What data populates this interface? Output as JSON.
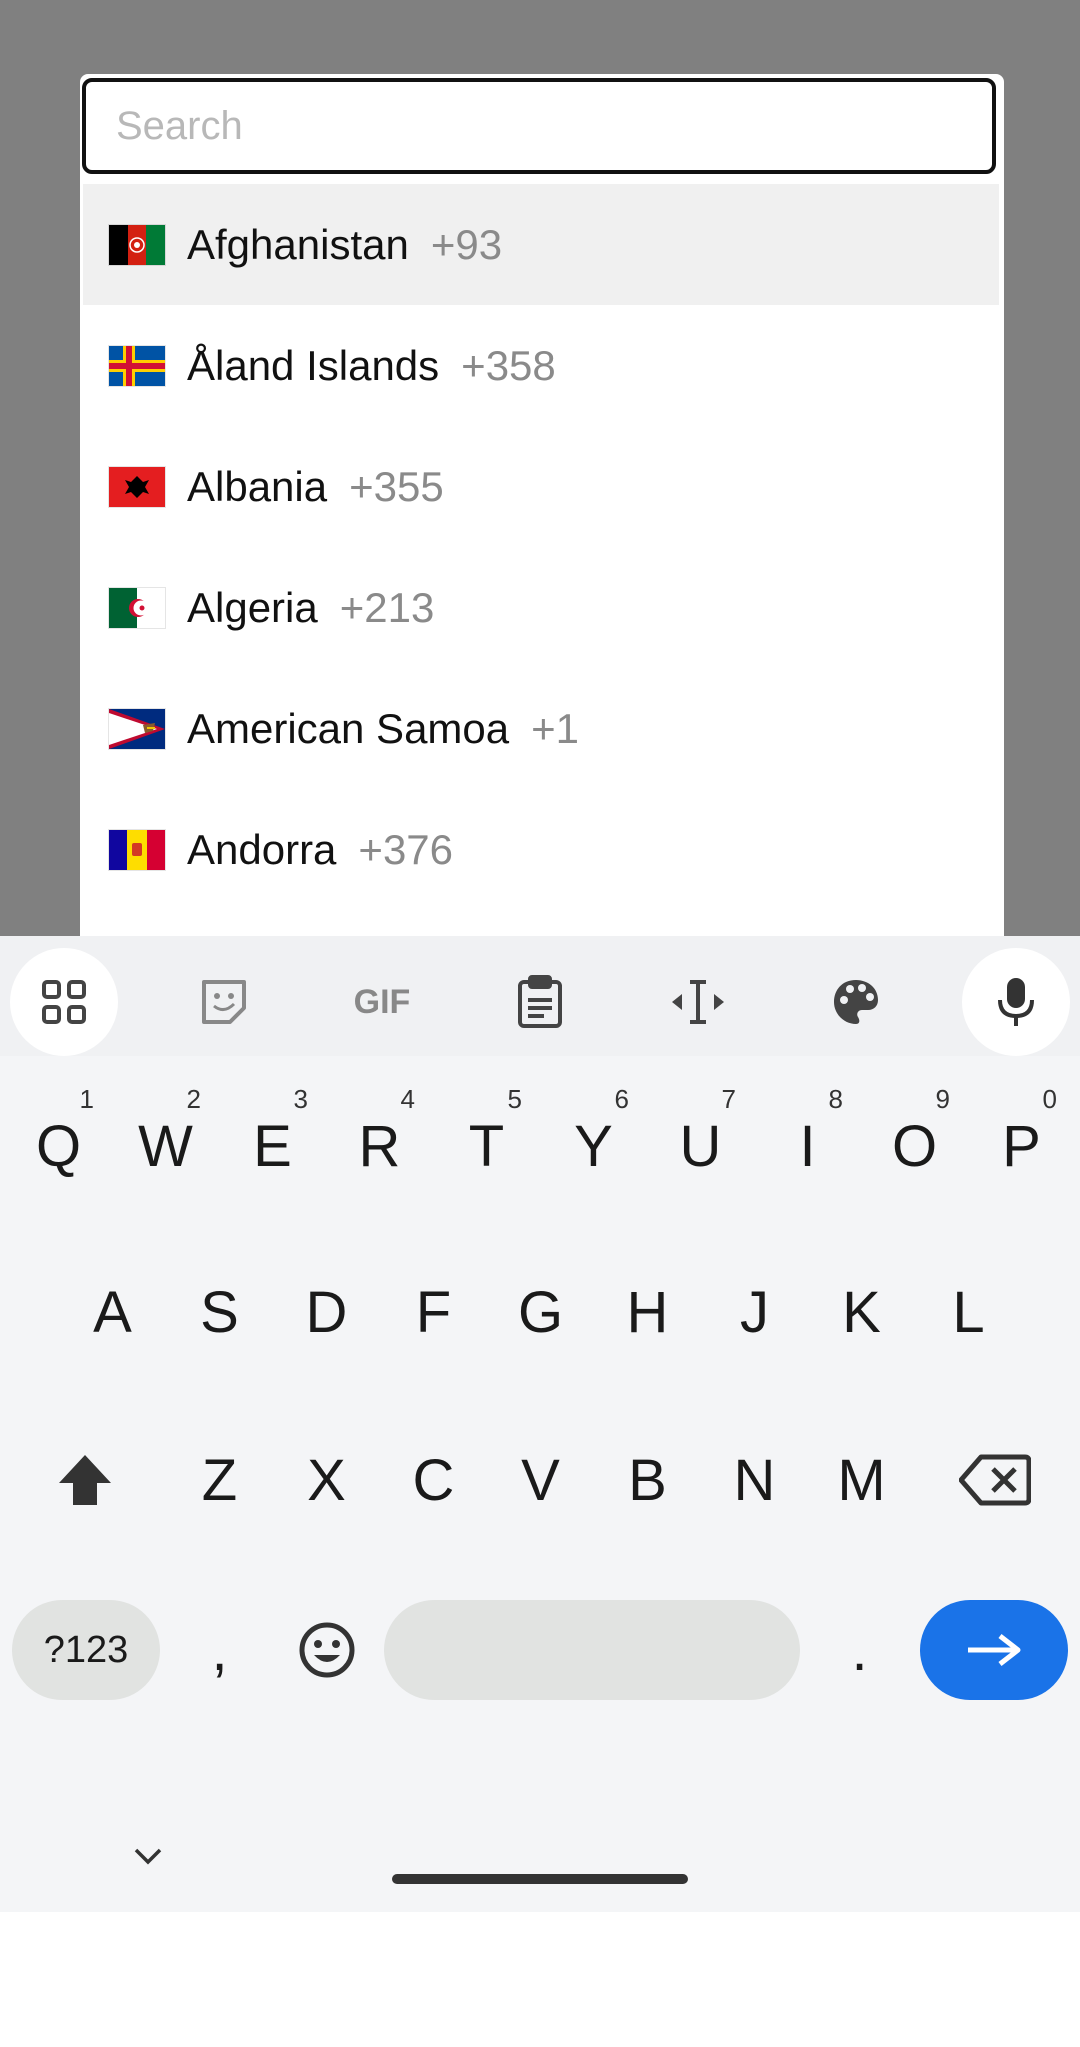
{
  "search": {
    "placeholder": "Search",
    "value": ""
  },
  "countries": [
    {
      "name": "Afghanistan",
      "code": "+93",
      "flag_icon": "afghanistan-flag-icon",
      "selected": true
    },
    {
      "name": "Åland Islands",
      "code": "+358",
      "flag_icon": "aland-islands-flag-icon",
      "selected": false
    },
    {
      "name": "Albania",
      "code": "+355",
      "flag_icon": "albania-flag-icon",
      "selected": false
    },
    {
      "name": "Algeria",
      "code": "+213",
      "flag_icon": "algeria-flag-icon",
      "selected": false
    },
    {
      "name": "American Samoa",
      "code": "+1",
      "flag_icon": "american-samoa-flag-icon",
      "selected": false
    },
    {
      "name": "Andorra",
      "code": "+376",
      "flag_icon": "andorra-flag-icon",
      "selected": false
    }
  ],
  "keyboard": {
    "toolbar": {
      "gif_label": "GIF",
      "icons": [
        "apps-grid-icon",
        "sticker-icon",
        "gif-icon",
        "clipboard-icon",
        "text-cursor-icon",
        "palette-icon",
        "microphone-icon"
      ]
    },
    "row1": [
      {
        "key": "Q",
        "hint": "1"
      },
      {
        "key": "W",
        "hint": "2"
      },
      {
        "key": "E",
        "hint": "3"
      },
      {
        "key": "R",
        "hint": "4"
      },
      {
        "key": "T",
        "hint": "5"
      },
      {
        "key": "Y",
        "hint": "6"
      },
      {
        "key": "U",
        "hint": "7"
      },
      {
        "key": "I",
        "hint": "8"
      },
      {
        "key": "O",
        "hint": "9"
      },
      {
        "key": "P",
        "hint": "0"
      }
    ],
    "row2": [
      "A",
      "S",
      "D",
      "F",
      "G",
      "H",
      "J",
      "K",
      "L"
    ],
    "row3": [
      "Z",
      "X",
      "C",
      "V",
      "B",
      "N",
      "M"
    ],
    "symbols_label": "?123",
    "comma": ",",
    "period": ".",
    "accent_color": "#1a73e8"
  }
}
